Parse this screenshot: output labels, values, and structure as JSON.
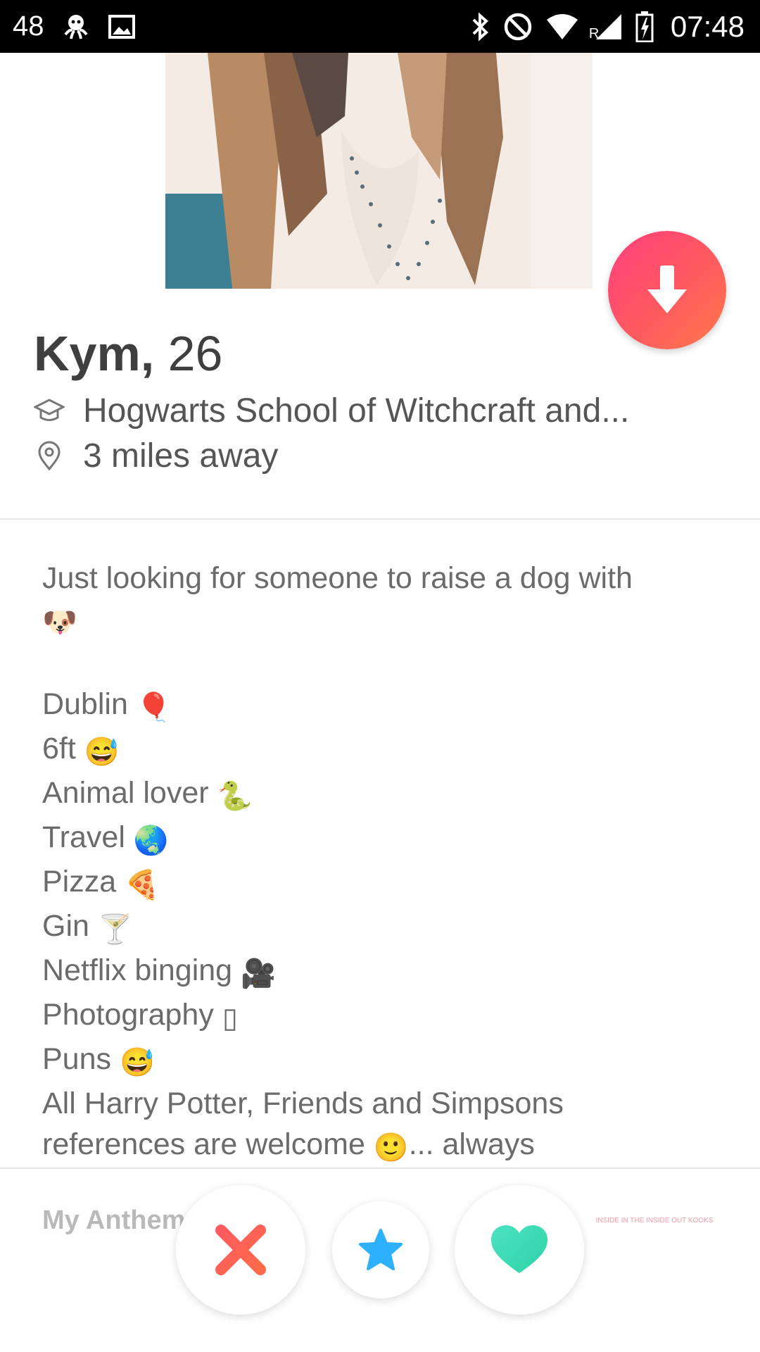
{
  "status_bar": {
    "left_number": "48",
    "time": "07:48",
    "roaming": "R",
    "icons": [
      "octopus-icon",
      "image-icon",
      "bluetooth-icon",
      "do-not-disturb-icon",
      "wifi-icon",
      "signal-icon",
      "battery-icon"
    ]
  },
  "profile": {
    "name": "Kym,",
    "age": "26",
    "school": "Hogwarts School of Witchcraft and...",
    "distance": "3 miles away"
  },
  "bio": {
    "lines": [
      {
        "text": "Just looking for someone to raise a dog with",
        "emoji": ""
      },
      {
        "text": "",
        "emoji": "🐶"
      },
      {
        "text": "",
        "emoji": ""
      },
      {
        "text": "Dublin",
        "emoji": "🎈"
      },
      {
        "text": "6ft",
        "emoji": "😅"
      },
      {
        "text": "Animal lover",
        "emoji": "🐍"
      },
      {
        "text": "Travel",
        "emoji": "🌏"
      },
      {
        "text": "Pizza",
        "emoji": "🍕"
      },
      {
        "text": "Gin",
        "emoji": "🍸"
      },
      {
        "text": "Netflix binging",
        "emoji": "🎥"
      },
      {
        "text": "Photography",
        "emoji": "▯"
      },
      {
        "text": "Puns",
        "emoji": "😅"
      },
      {
        "text": "All Harry Potter, Friends and Simpsons",
        "emoji": ""
      },
      {
        "text": "references are welcome",
        "emoji": "🙂",
        "suffix": "... always"
      }
    ]
  },
  "anthem_label": "My Anthem",
  "actions": [
    "nope-button",
    "super-like-button",
    "like-button"
  ],
  "watermark": "INSIDE IN THE INSIDE OUT KOOKS",
  "colors": {
    "nope": "#ff5864",
    "super_like": "#2db1ff",
    "like": "#3fe0b5",
    "collapse_start": "#ff3f7e",
    "collapse_end": "#ff7a4a"
  }
}
